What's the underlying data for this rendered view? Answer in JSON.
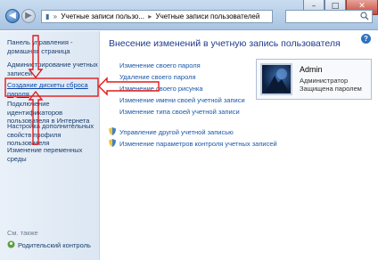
{
  "address": {
    "path": [
      "Учетные записи пользо...",
      "Учетные записи пользователей"
    ]
  },
  "left_pane": {
    "items": [
      "Панель управления - домашняя страница",
      "Администрирование учетных записей",
      "Создание дискеты сброса пароля",
      "Подключение идентификаторов пользователя в Интернета",
      "Настройка дополнительных свойств профиля пользователя",
      "Изменение переменных среды"
    ],
    "see_also": "См. также",
    "parental_control": "Родительский контроль"
  },
  "main": {
    "title": "Внесение изменений в учетную запись пользователя",
    "tasks": [
      "Изменение своего пароля",
      "Удаление своего пароля",
      "Изменение своего рисунка",
      "Изменение имени своей учетной записи",
      "Изменение типа своей учетной записи"
    ],
    "shield_tasks": [
      "Управление другой учетной записью",
      "Изменение параметров контроля учетных записей"
    ]
  },
  "user": {
    "name": "Admin",
    "role": "Администратор",
    "status": "Защищена паролем"
  },
  "colors": {
    "annotation": "#e11b1b",
    "link": "#1a57a8"
  },
  "icons": [
    "back-icon",
    "forward-icon",
    "search-icon",
    "help-icon",
    "shield-icon",
    "parental-control-icon"
  ]
}
